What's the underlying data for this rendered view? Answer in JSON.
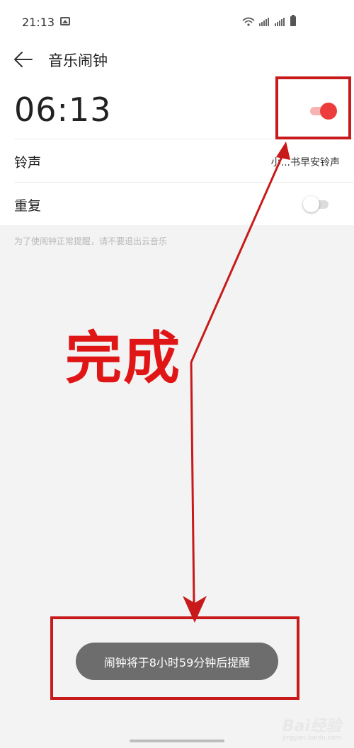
{
  "status_bar": {
    "time": "21:13"
  },
  "app_bar": {
    "title": "音乐闹钟"
  },
  "alarm": {
    "time": "06:13",
    "enabled": true
  },
  "settings": {
    "ringtone_label": "铃声",
    "ringtone_value": "小...书早安铃声",
    "repeat_label": "重复",
    "repeat_enabled": false
  },
  "hint": "为了使闹钟正常提醒，请不要退出云音乐",
  "toast": "闹钟将于8小时59分钟后提醒",
  "annotation": {
    "text": "完成",
    "color": "#e01616"
  },
  "watermark": {
    "brand": "Bai经验",
    "sub": "jingyan.baidu.com"
  },
  "colors": {
    "accent": "#ec3c3c",
    "toast_bg": "#6d6d6d"
  }
}
